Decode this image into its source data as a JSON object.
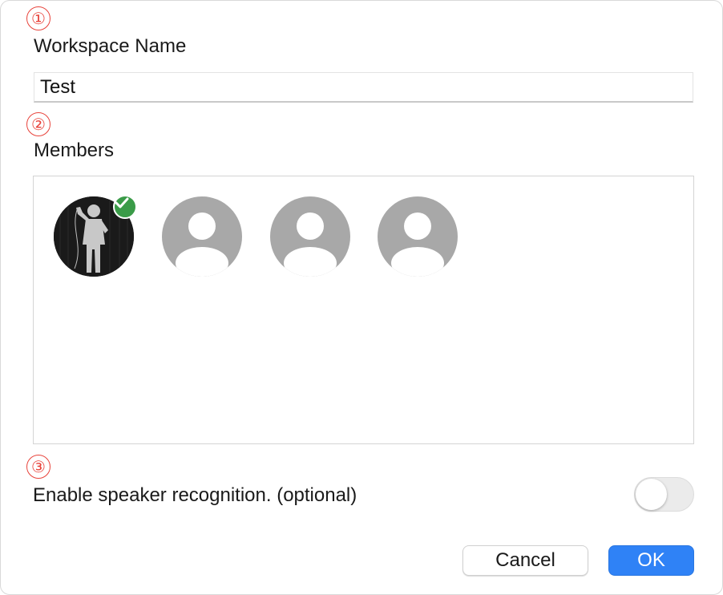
{
  "steps": {
    "s1": "①",
    "s2": "②",
    "s3": "③"
  },
  "workspace": {
    "label": "Workspace Name",
    "value": "Test"
  },
  "members": {
    "label": "Members",
    "items": [
      {
        "type": "photo",
        "selected": true,
        "icon": "user-photo"
      },
      {
        "type": "placeholder",
        "selected": false,
        "icon": "person-icon"
      },
      {
        "type": "placeholder",
        "selected": false,
        "icon": "person-icon"
      },
      {
        "type": "placeholder",
        "selected": false,
        "icon": "person-icon"
      }
    ]
  },
  "speaker": {
    "label": "Enable speaker recognition. (optional)",
    "enabled": false
  },
  "buttons": {
    "cancel": "Cancel",
    "ok": "OK"
  },
  "colors": {
    "accent": "#2f82f6",
    "step_marker": "#e8433b",
    "selected_check": "#3a9b48",
    "placeholder_avatar": "#a8a8a8"
  }
}
